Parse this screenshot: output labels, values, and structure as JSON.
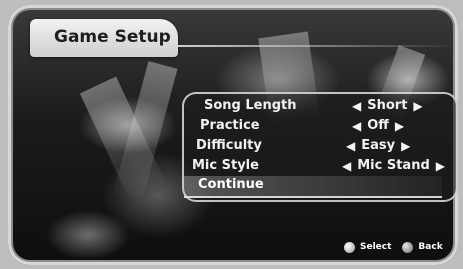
{
  "screen": {
    "title": "Game Setup"
  },
  "menu": {
    "options": [
      {
        "label": "Song Length",
        "value": "Short"
      },
      {
        "label": "Practice",
        "value": "Off"
      },
      {
        "label": "Difficulty",
        "value": "Easy"
      },
      {
        "label": "Mic Style",
        "value": "Mic Stand"
      }
    ],
    "continue_label": "Continue",
    "selected": "Continue",
    "arrow_icon": "arrow-left-right-icon"
  },
  "controls": {
    "select_label": "Select",
    "back_label": "Back"
  }
}
